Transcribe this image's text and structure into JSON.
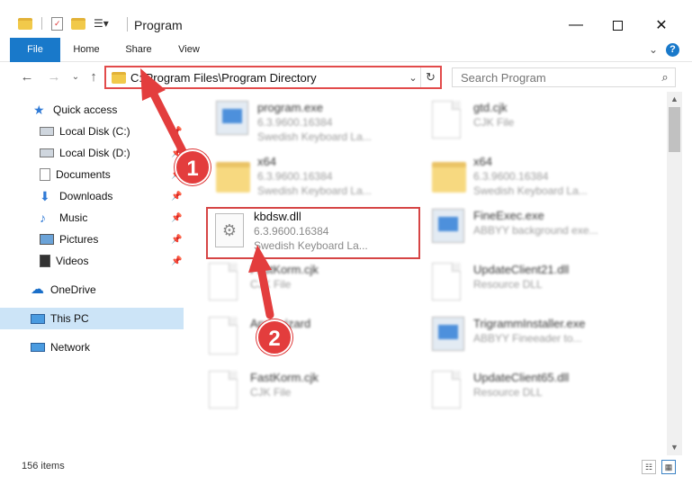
{
  "window": {
    "title": "Program",
    "minimize_icon": "minimize-icon",
    "maximize_icon": "maximize-icon",
    "close_icon": "close-icon"
  },
  "ribbon": {
    "tabs": [
      {
        "label": "File"
      },
      {
        "label": "Home"
      },
      {
        "label": "Share"
      },
      {
        "label": "View"
      }
    ],
    "help_label": "?"
  },
  "nav": {
    "address": "C:\\Program Files\\Program Directory",
    "search_placeholder": "Search Program"
  },
  "sidebar": {
    "items": [
      {
        "label": "Quick access",
        "icon": "star-icon"
      },
      {
        "label": "Local Disk (C:)",
        "icon": "drive-icon"
      },
      {
        "label": "Local Disk (D:)",
        "icon": "drive-icon"
      },
      {
        "label": "Documents",
        "icon": "documents-icon"
      },
      {
        "label": "Downloads",
        "icon": "download-icon"
      },
      {
        "label": "Music",
        "icon": "music-icon"
      },
      {
        "label": "Pictures",
        "icon": "pictures-icon"
      },
      {
        "label": "Videos",
        "icon": "videos-icon"
      },
      {
        "label": "OneDrive",
        "icon": "cloud-icon"
      },
      {
        "label": "This PC",
        "icon": "computer-icon"
      },
      {
        "label": "Network",
        "icon": "network-icon"
      }
    ]
  },
  "files": {
    "left": [
      {
        "name": "program.exe",
        "line2": "6.3.9600.16384",
        "line3": "Swedish Keyboard La..."
      },
      {
        "name": "x64",
        "line2": "6.3.9600.16384",
        "line3": "Swedish Keyboard La..."
      },
      {
        "name": "kbdsw.dll",
        "line2": "6.3.9600.16384",
        "line3": "Swedish Keyboard La..."
      },
      {
        "name": "FastKorm.cjk",
        "line2": "CJK File",
        "line3": ""
      },
      {
        "name": "Apptiwizard",
        "line2": "",
        "line3": ""
      },
      {
        "name": "FastKorm.cjk",
        "line2": "CJK File",
        "line3": ""
      }
    ],
    "right": [
      {
        "name": "gtd.cjk",
        "line2": "CJK File",
        "line3": ""
      },
      {
        "name": "x64",
        "line2": "6.3.9600.16384",
        "line3": "Swedish Keyboard La..."
      },
      {
        "name": "FineExec.exe",
        "line2": "ABBYY background exe...",
        "line3": ""
      },
      {
        "name": "UpdateClient21.dll",
        "line2": "Resource DLL",
        "line3": ""
      },
      {
        "name": "TrigrammInstaller.exe",
        "line2": "ABBYY Fineeader to...",
        "line3": ""
      },
      {
        "name": "UpdateClient65.dll",
        "line2": "Resource DLL",
        "line3": ""
      }
    ]
  },
  "annotations": {
    "marker1": "1",
    "marker2": "2",
    "color": "#e33d3d"
  },
  "status": {
    "count": "156 items"
  }
}
